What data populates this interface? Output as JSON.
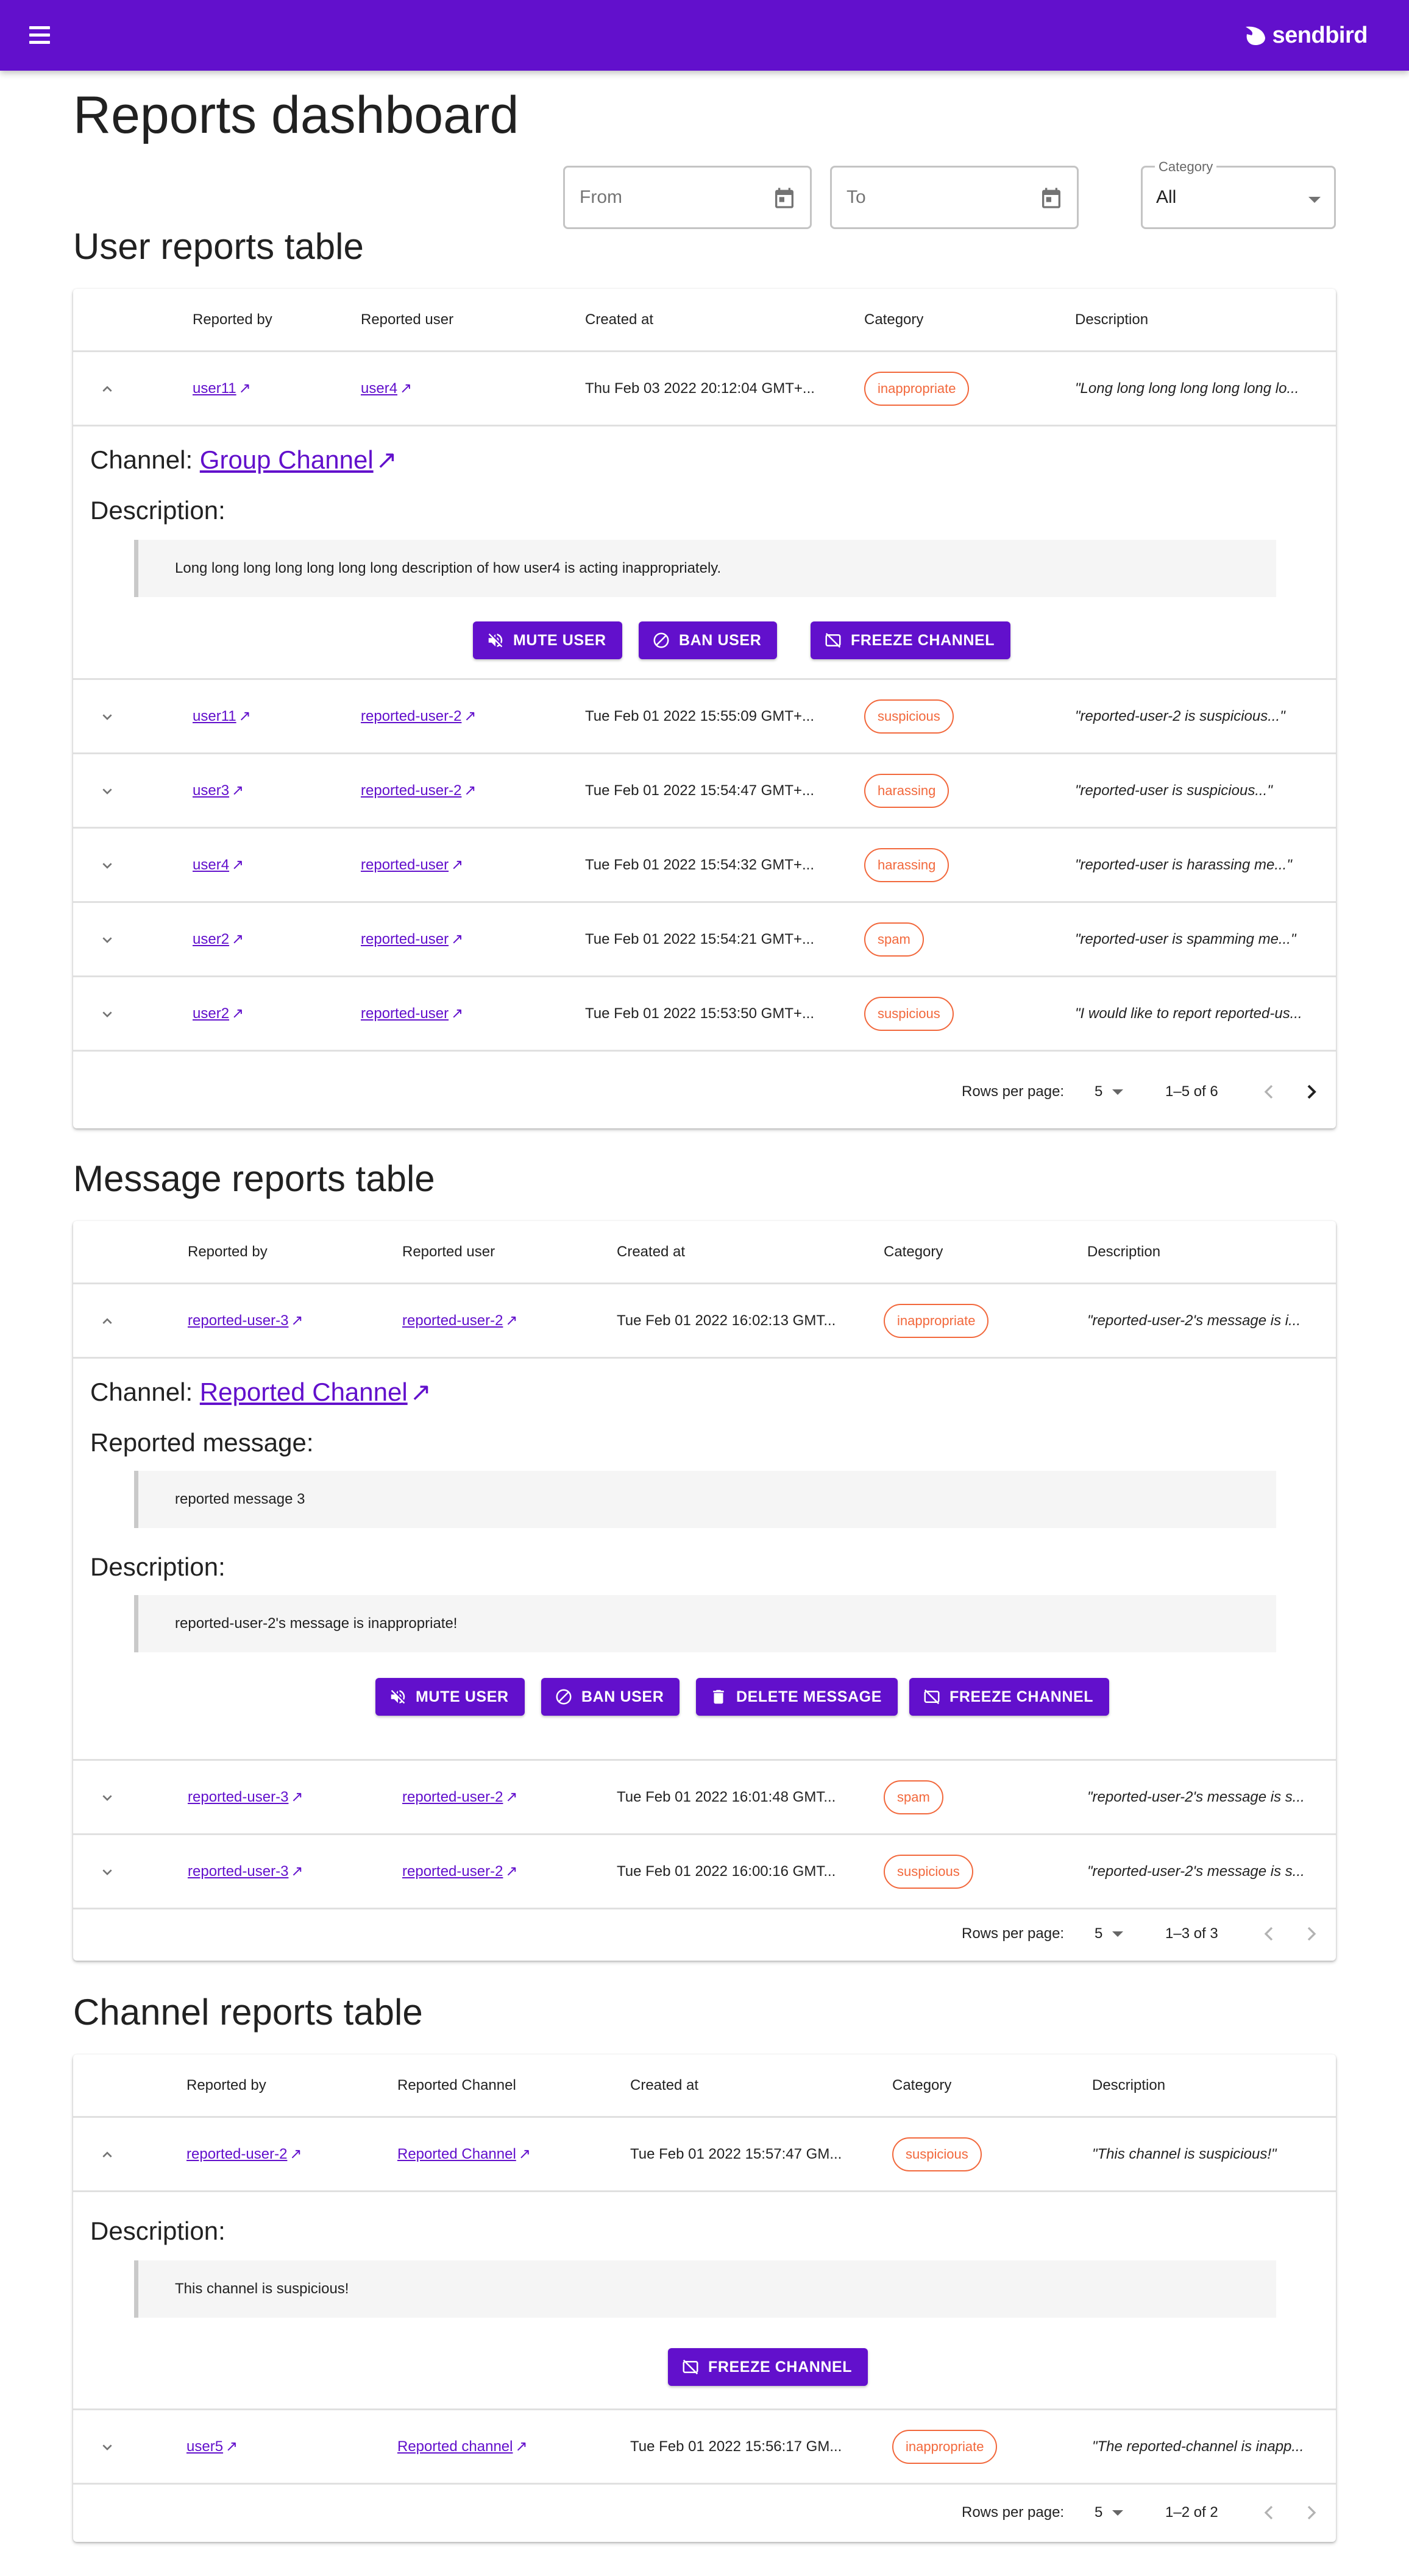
{
  "app": {
    "brand": "sendbird",
    "title": "Reports dashboard"
  },
  "filters": {
    "from_placeholder": "From",
    "to_placeholder": "To",
    "category_label": "Category",
    "category_value": "All"
  },
  "user_reports": {
    "title": "User reports table",
    "headers": [
      "Reported by",
      "Reported user",
      "Created at",
      "Category",
      "Description"
    ],
    "expanded": {
      "channel_label": "Channel:",
      "channel_link": "Group Channel",
      "description_label": "Description:",
      "description_text": "Long long long long long long long description of how user4 is acting inappropriately.",
      "buttons": [
        "MUTE USER",
        "BAN USER",
        "FREEZE CHANNEL"
      ]
    },
    "rows": [
      {
        "reported_by": "user11",
        "reported_user": "user4",
        "created_at": "Thu Feb 03 2022 20:12:04 GMT+...",
        "category": "inappropriate",
        "description": "\"Long long long long long long lo..."
      },
      {
        "reported_by": "user11",
        "reported_user": "reported-user-2",
        "created_at": "Tue Feb 01 2022 15:55:09 GMT+...",
        "category": "suspicious",
        "description": "\"reported-user-2 is suspicious...\""
      },
      {
        "reported_by": "user3",
        "reported_user": "reported-user-2",
        "created_at": "Tue Feb 01 2022 15:54:47 GMT+...",
        "category": "harassing",
        "description": "\"reported-user is suspicious...\""
      },
      {
        "reported_by": "user4",
        "reported_user": "reported-user",
        "created_at": "Tue Feb 01 2022 15:54:32 GMT+...",
        "category": "harassing",
        "description": "\"reported-user is harassing me...\""
      },
      {
        "reported_by": "user2",
        "reported_user": "reported-user",
        "created_at": "Tue Feb 01 2022 15:54:21 GMT+...",
        "category": "spam",
        "description": "\"reported-user is spamming me...\""
      },
      {
        "reported_by": "user2",
        "reported_user": "reported-user",
        "created_at": "Tue Feb 01 2022 15:53:50 GMT+...",
        "category": "suspicious",
        "description": "\"I would like to report reported-us..."
      }
    ],
    "pagination": {
      "rows_per_page_label": "Rows per page:",
      "rows_per_page": "5",
      "range": "1–5 of 6"
    }
  },
  "message_reports": {
    "title": "Message reports table",
    "headers": [
      "Reported by",
      "Reported user",
      "Created at",
      "Category",
      "Description"
    ],
    "expanded": {
      "channel_label": "Channel:",
      "channel_link": "Reported Channel",
      "message_label": "Reported message:",
      "message_text": "reported message 3",
      "description_label": "Description:",
      "description_text": "reported-user-2's message is inappropriate!",
      "buttons": [
        "MUTE USER",
        "BAN USER",
        "DELETE MESSAGE",
        "FREEZE CHANNEL"
      ]
    },
    "rows": [
      {
        "reported_by": "reported-user-3",
        "reported_user": "reported-user-2",
        "created_at": "Tue Feb 01 2022 16:02:13 GMT...",
        "category": "inappropriate",
        "description": "\"reported-user-2's message is i..."
      },
      {
        "reported_by": "reported-user-3",
        "reported_user": "reported-user-2",
        "created_at": "Tue Feb 01 2022 16:01:48 GMT...",
        "category": "spam",
        "description": "\"reported-user-2's message is s..."
      },
      {
        "reported_by": "reported-user-3",
        "reported_user": "reported-user-2",
        "created_at": "Tue Feb 01 2022 16:00:16 GMT...",
        "category": "suspicious",
        "description": "\"reported-user-2's message is s..."
      }
    ],
    "pagination": {
      "rows_per_page_label": "Rows per page:",
      "rows_per_page": "5",
      "range": "1–3 of 3"
    }
  },
  "channel_reports": {
    "title": "Channel reports table",
    "headers": [
      "Reported by",
      "Reported Channel",
      "Created at",
      "Category",
      "Description"
    ],
    "expanded": {
      "description_label": "Description:",
      "description_text": "This channel is suspicious!",
      "buttons": [
        "FREEZE CHANNEL"
      ]
    },
    "rows": [
      {
        "reported_by": "reported-user-2",
        "reported_channel": "Reported Channel",
        "created_at": "Tue Feb 01 2022 15:57:47 GM...",
        "category": "suspicious",
        "description": "\"This channel is suspicious!\""
      },
      {
        "reported_by": "user5",
        "reported_channel": "Reported channel",
        "created_at": "Tue Feb 01 2022 15:56:17 GM...",
        "category": "inappropriate",
        "description": "\"The reported-channel is inapp..."
      }
    ],
    "pagination": {
      "rows_per_page_label": "Rows per page:",
      "rows_per_page": "5",
      "range": "1–2 of 2"
    }
  },
  "colors": {
    "brand": "#6210cc",
    "chip": "#f2683c"
  }
}
